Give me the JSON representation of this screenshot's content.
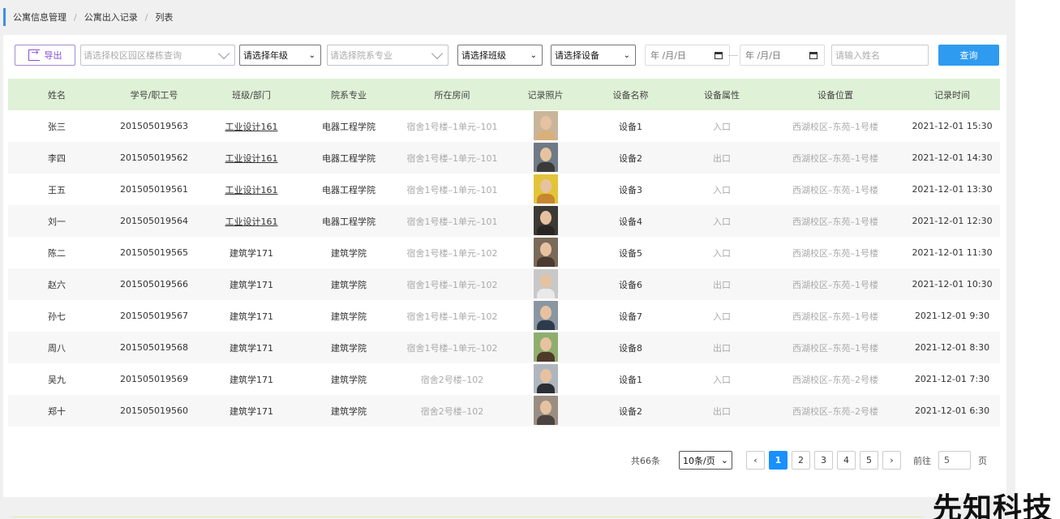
{
  "breadcrumb": [
    "公寓信息管理",
    "公寓出入记录",
    "列表"
  ],
  "toolbar": {
    "export_label": "导出",
    "building_placeholder": "请选择校区园区楼栋查询",
    "grade_select": "请选择年级",
    "college_placeholder": "请选择院系专业",
    "class_select": "请选择班级",
    "device_select": "请选择设备",
    "date_start": "年 /月/日",
    "date_end": "年 /月/日",
    "name_placeholder": "请输入姓名",
    "query_label": "查询"
  },
  "table": {
    "headers": [
      "姓名",
      "学号/职工号",
      "班级/部门",
      "院系专业",
      "所在房间",
      "记录照片",
      "设备名称",
      "设备属性",
      "设备位置",
      "记录时间"
    ],
    "rows": [
      {
        "name": "张三",
        "id": "201505019563",
        "class": "工业设计161",
        "college": "电器工程学院",
        "room": "宿舍1号楼–1单元–101",
        "device": "设备1",
        "attr": "入口",
        "location": "西湖校区–东苑–1号楼",
        "time": "2021-12-01 15:30"
      },
      {
        "name": "李四",
        "id": "201505019562",
        "class": "工业设计161",
        "college": "电器工程学院",
        "room": "宿舍1号楼–1单元–101",
        "device": "设备2",
        "attr": "出口",
        "location": "西湖校区–东苑–1号楼",
        "time": "2021-12-01 14:30"
      },
      {
        "name": "王五",
        "id": "201505019561",
        "class": "工业设计161",
        "college": "电器工程学院",
        "room": "宿舍1号楼–1单元–101",
        "device": "设备3",
        "attr": "入口",
        "location": "西湖校区–东苑–1号楼",
        "time": "2021-12-01 13:30"
      },
      {
        "name": "刘一",
        "id": "201505019564",
        "class": "工业设计161",
        "college": "电器工程学院",
        "room": "宿舍1号楼–1单元–101",
        "device": "设备4",
        "attr": "入口",
        "location": "西湖校区–东苑–1号楼",
        "time": "2021-12-01 12:30"
      },
      {
        "name": "陈二",
        "id": "201505019565",
        "class": "建筑学171",
        "college": "建筑学院",
        "room": "宿舍1号楼–1单元–102",
        "device": "设备5",
        "attr": "入口",
        "location": "西湖校区–东苑–1号楼",
        "time": "2021-12-01 11:30"
      },
      {
        "name": "赵六",
        "id": "201505019566",
        "class": "建筑学171",
        "college": "建筑学院",
        "room": "宿舍1号楼–1单元–102",
        "device": "设备6",
        "attr": "出口",
        "location": "西湖校区–东苑–1号楼",
        "time": "2021-12-01 10:30"
      },
      {
        "name": "孙七",
        "id": "201505019567",
        "class": "建筑学171",
        "college": "建筑学院",
        "room": "宿舍1号楼–1单元–102",
        "device": "设备7",
        "attr": "入口",
        "location": "西湖校区–东苑–1号楼",
        "time": "2021-12-01 9:30"
      },
      {
        "name": "周八",
        "id": "201505019568",
        "class": "建筑学171",
        "college": "建筑学院",
        "room": "宿舍1号楼–1单元–102",
        "device": "设备8",
        "attr": "出口",
        "location": "西湖校区–东苑–1号楼",
        "time": "2021-12-01 8:30"
      },
      {
        "name": "吴九",
        "id": "201505019569",
        "class": "建筑学171",
        "college": "建筑学院",
        "room": "宿舍2号楼–102",
        "device": "设备1",
        "attr": "入口",
        "location": "西湖校区–东苑–2号楼",
        "time": "2021-12-01 7:30"
      },
      {
        "name": "郑十",
        "id": "201505019560",
        "class": "建筑学171",
        "college": "建筑学院",
        "room": "宿舍2号楼–102",
        "device": "设备2",
        "attr": "出口",
        "location": "西湖校区–东苑–2号楼",
        "time": "2021-12-01 6:30"
      }
    ]
  },
  "pager": {
    "total": "共66条",
    "page_size": "10条/页",
    "pages": [
      "1",
      "2",
      "3",
      "4",
      "5"
    ],
    "active_page": "1",
    "prev": "‹",
    "next": "›",
    "goto_label": "前往",
    "goto_value": "5",
    "page_unit": "页"
  },
  "watermark": "先知科技",
  "colors": {
    "accent": "#1890ff",
    "header_bg": "#dff1d6",
    "export": "#8a4fd6"
  }
}
